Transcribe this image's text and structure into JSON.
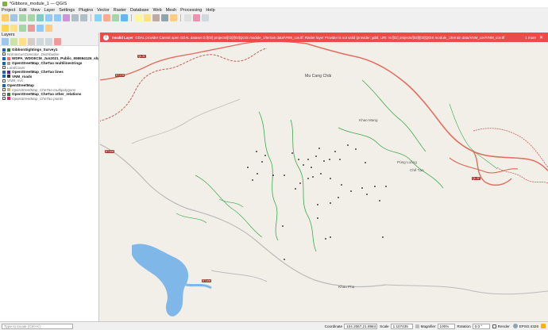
{
  "window": {
    "title": "*Gibbons_module_1 — QGIS"
  },
  "menu": [
    "Project",
    "Edit",
    "View",
    "Layer",
    "Settings",
    "Plugins",
    "Vector",
    "Raster",
    "Database",
    "Web",
    "Mesh",
    "Processing",
    "Help"
  ],
  "layers_panel": {
    "title": "Layers",
    "layers": [
      {
        "label": "GibbonSightings_Survey1",
        "style": "bold",
        "checked": true,
        "color": "#2e7d32"
      },
      {
        "label": "NomascusConcolor_Distribution",
        "style": "sub",
        "checked": false,
        "color": ""
      },
      {
        "label": "WDPA_WDOECM_Jun2021_Public_555594126_shp-polygons",
        "style": "bold",
        "checked": true,
        "color": "#e57373"
      },
      {
        "label": "OpenStreetMap_CheTao multilinestrings",
        "style": "bold",
        "checked": true,
        "color": "#9e9e9e"
      },
      {
        "label": "LandCover",
        "style": "sub",
        "checked": false,
        "color": ""
      },
      {
        "label": "OpenStreetMap_CheTao lines",
        "style": "bold",
        "checked": true,
        "color": "#6a1b9a"
      },
      {
        "label": "VNM_roads",
        "style": "bold",
        "checked": true,
        "color": "#333333"
      },
      {
        "label": "VNM_rivs",
        "style": "sub",
        "checked": false,
        "color": ""
      },
      {
        "label": "OpenStreetMap",
        "style": "bold",
        "checked": true,
        "color": ""
      },
      {
        "label": "OpenStreetMap_CheTao multipolygons",
        "style": "sub",
        "checked": false,
        "color": "#c8b273"
      },
      {
        "label": "OpenStreetMap_CheTao other_relations",
        "style": "bold",
        "checked": false,
        "color": "#2e7d32"
      },
      {
        "label": "OpenStreetMap_CheTao points",
        "style": "sub",
        "checked": false,
        "color": "#e91e63"
      }
    ]
  },
  "message_bar": {
    "title": "Invalid Layer",
    "text": "GDAL provider Cannot open GDAL dataset D:/[02] projects/[02]/[02]QGIS module_1/terrain data/VNM_cov.tif: Raster layer Provider is not valid (provider: gdal, URI: N:/[02] projects/[02]/[02]QGIS module_1/terrain data/VNM_cov/VNM_cov.tif",
    "more": "1 more",
    "close": "✕"
  },
  "map_labels": [
    {
      "text": "Mu Cang Chải",
      "kind": "town"
    },
    {
      "text": "Púng Luông",
      "kind": "town"
    },
    {
      "text": "Khao Mang",
      "kind": "village"
    },
    {
      "text": "Chế Tạo",
      "kind": "village"
    },
    {
      "text": "Khau Phạ",
      "kind": "village"
    }
  ],
  "road_badges": [
    "QL.32",
    "ĐT.175",
    "ĐT.106",
    "QL.32",
    "ĐT.106"
  ],
  "status": {
    "search_placeholder": "Type to locate (Ctrl+K)",
    "coordinate_label": "Coordinate",
    "coordinate": "104.2067,21.8984",
    "scale_label": "Scale",
    "scale": "1:107435",
    "magnifier_label": "Magnifier",
    "magnifier": "100%",
    "rotation_label": "Rotation",
    "rotation": "0.0 °",
    "render_label": "Render",
    "crs": "EPSG:4326"
  },
  "colors": {
    "map_background": "#f2efe9",
    "error_bar": "#ef4a4a",
    "sighting_point": "#111111",
    "road_primary": "#e07060",
    "road_secondary": "#c9c9c9",
    "river": "#3aa94a",
    "water": "#7fb8e8",
    "protected_area": "#c0605a"
  },
  "icons": {
    "toolbar": [
      "pan-icon",
      "pan-to-selection-icon",
      "zoom-in-icon",
      "zoom-out-icon",
      "zoom-full-icon",
      "zoom-to-selection-icon",
      "zoom-to-layer-icon",
      "zoom-native-icon",
      "zoom-last-icon",
      "zoom-next-icon",
      "new-map-view-icon",
      "temporal-icon",
      "refresh-icon",
      "identify-icon",
      "select-icon",
      "deselect-icon",
      "field-calculator-icon",
      "statistics-icon",
      "measure-icon",
      "map-tips-icon",
      "annotation-icon",
      "text-annotation-icon"
    ]
  }
}
